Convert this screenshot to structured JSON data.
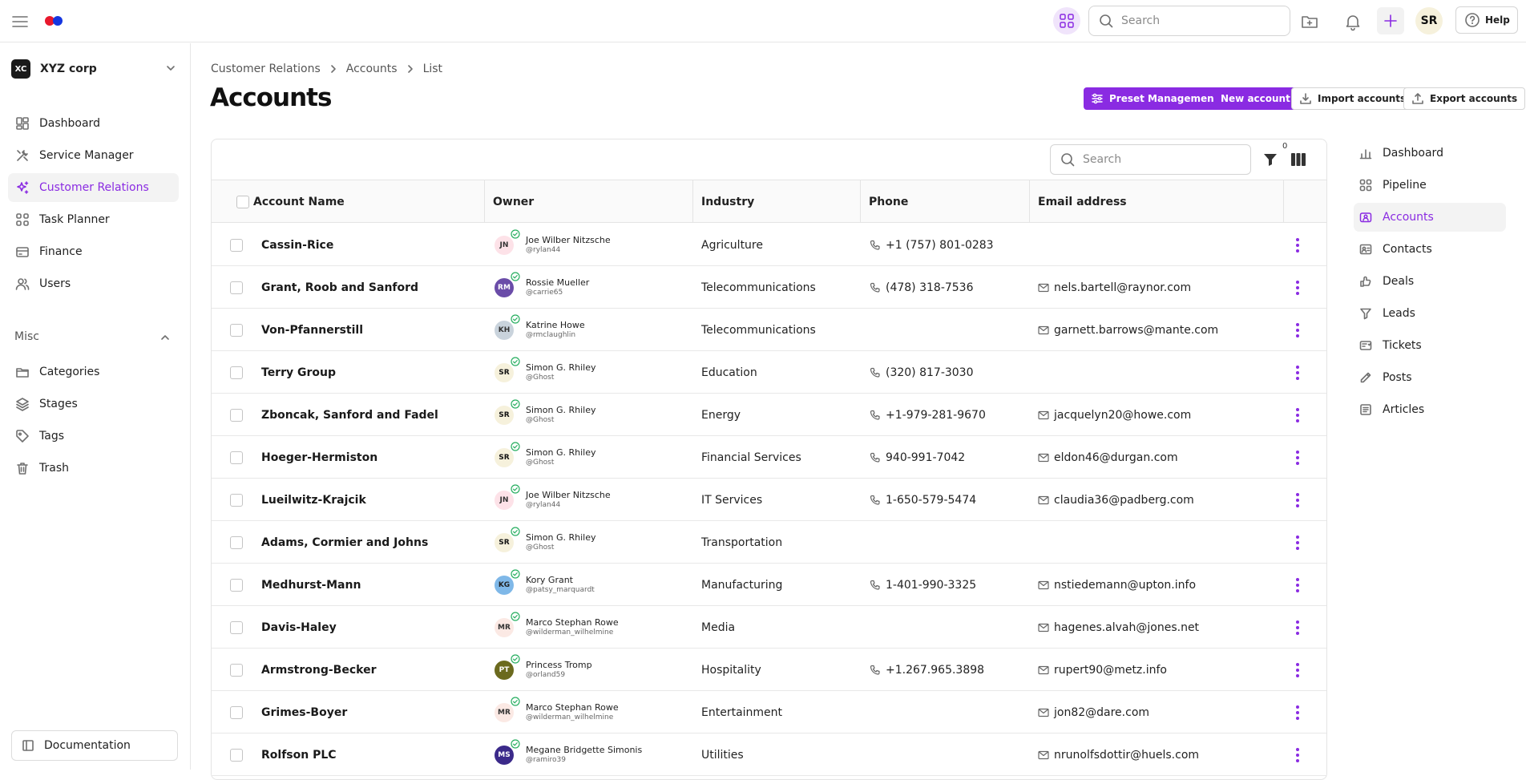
{
  "topbar": {
    "search_placeholder": "Search",
    "user_initials": "SR",
    "help_label": "Help",
    "accent": "#8a2be2",
    "logo_colors": [
      "#e8182c",
      "#1536e0"
    ]
  },
  "sidebar": {
    "org": {
      "badge": "XC",
      "name": "XYZ corp"
    },
    "items": [
      {
        "label": "Dashboard",
        "icon": "dashboard-icon"
      },
      {
        "label": "Service Manager",
        "icon": "tools-icon"
      },
      {
        "label": "Customer Relations",
        "icon": "sparkle-icon",
        "active": true
      },
      {
        "label": "Task Planner",
        "icon": "grid-icon"
      },
      {
        "label": "Finance",
        "icon": "wallet-icon"
      },
      {
        "label": "Users",
        "icon": "users-icon"
      }
    ],
    "misc_label": "Misc",
    "misc_items": [
      {
        "label": "Categories",
        "icon": "folder-icon"
      },
      {
        "label": "Stages",
        "icon": "layers-icon"
      },
      {
        "label": "Tags",
        "icon": "tag-icon"
      },
      {
        "label": "Trash",
        "icon": "trash-icon"
      }
    ],
    "documentation_label": "Documentation"
  },
  "breadcrumb": [
    "Customer Relations",
    "Accounts",
    "List"
  ],
  "page_title": "Accounts",
  "actions": {
    "preset": "Preset Management",
    "new_account": "New account",
    "import": "Import accounts",
    "export": "Export accounts"
  },
  "table": {
    "search_placeholder": "Search",
    "filter_count": "0",
    "columns": [
      "Account Name",
      "Owner",
      "Industry",
      "Phone",
      "Email address"
    ],
    "rows": [
      {
        "name": "Cassin-Rice",
        "owner": {
          "initials": "JN",
          "name": "Joe Wilber Nitzsche",
          "user": "@rylan44",
          "bg": "#fde2e8",
          "fg": "#333"
        },
        "industry": "Agriculture",
        "phone": "+1 (757) 801-0283",
        "email": ""
      },
      {
        "name": "Grant, Roob and Sanford",
        "owner": {
          "initials": "RM",
          "name": "Rossie Mueller",
          "user": "@carrie65",
          "bg": "#6a4ca8",
          "fg": "#fff"
        },
        "industry": "Telecommunications",
        "phone": "(478) 318-7536",
        "email": "nels.bartell@raynor.com"
      },
      {
        "name": "Von-Pfannerstill",
        "owner": {
          "initials": "KH",
          "name": "Katrine Howe",
          "user": "@rmclaughlin",
          "bg": "#c9d3dc",
          "fg": "#333"
        },
        "industry": "Telecommunications",
        "phone": "",
        "email": "garnett.barrows@mante.com"
      },
      {
        "name": "Terry Group",
        "owner": {
          "initials": "SR",
          "name": "Simon G. Rhiley",
          "user": "@Ghost",
          "bg": "#f6f1dc",
          "fg": "#111"
        },
        "industry": "Education",
        "phone": "(320) 817-3030",
        "email": ""
      },
      {
        "name": "Zboncak, Sanford and Fadel",
        "owner": {
          "initials": "SR",
          "name": "Simon G. Rhiley",
          "user": "@Ghost",
          "bg": "#f6f1dc",
          "fg": "#111"
        },
        "industry": "Energy",
        "phone": "+1-979-281-9670",
        "email": "jacquelyn20@howe.com"
      },
      {
        "name": "Hoeger-Hermiston",
        "owner": {
          "initials": "SR",
          "name": "Simon G. Rhiley",
          "user": "@Ghost",
          "bg": "#f6f1dc",
          "fg": "#111"
        },
        "industry": "Financial Services",
        "phone": "940-991-7042",
        "email": "eldon46@durgan.com"
      },
      {
        "name": "Lueilwitz-Krajcik",
        "owner": {
          "initials": "JN",
          "name": "Joe Wilber Nitzsche",
          "user": "@rylan44",
          "bg": "#fde2e8",
          "fg": "#333"
        },
        "industry": "IT Services",
        "phone": "1-650-579-5474",
        "email": "claudia36@padberg.com"
      },
      {
        "name": "Adams, Cormier and Johns",
        "owner": {
          "initials": "SR",
          "name": "Simon G. Rhiley",
          "user": "@Ghost",
          "bg": "#f6f1dc",
          "fg": "#111"
        },
        "industry": "Transportation",
        "phone": "",
        "email": ""
      },
      {
        "name": "Medhurst-Mann",
        "owner": {
          "initials": "KG",
          "name": "Kory Grant",
          "user": "@patsy_marquardt",
          "bg": "#7fb8e8",
          "fg": "#222"
        },
        "industry": "Manufacturing",
        "phone": "1-401-990-3325",
        "email": "nstiedemann@upton.info"
      },
      {
        "name": "Davis-Haley",
        "owner": {
          "initials": "MR",
          "name": "Marco Stephan Rowe",
          "user": "@wilderman_wilhelmine",
          "bg": "#fbe9e4",
          "fg": "#333"
        },
        "industry": "Media",
        "phone": "",
        "email": "hagenes.alvah@jones.net"
      },
      {
        "name": "Armstrong-Becker",
        "owner": {
          "initials": "PT",
          "name": "Princess Tromp",
          "user": "@orland59",
          "bg": "#6b6a1e",
          "fg": "#fff"
        },
        "industry": "Hospitality",
        "phone": "+1.267.965.3898",
        "email": "rupert90@metz.info"
      },
      {
        "name": "Grimes-Boyer",
        "owner": {
          "initials": "MR",
          "name": "Marco Stephan Rowe",
          "user": "@wilderman_wilhelmine",
          "bg": "#fbe9e4",
          "fg": "#333"
        },
        "industry": "Entertainment",
        "phone": "",
        "email": "jon82@dare.com"
      },
      {
        "name": "Rolfson PLC",
        "owner": {
          "initials": "MS",
          "name": "Megane Bridgette Simonis",
          "user": "@ramiro39",
          "bg": "#3b2a8a",
          "fg": "#fff"
        },
        "industry": "Utilities",
        "phone": "",
        "email": "nrunolfsdottir@huels.com"
      }
    ]
  },
  "right_nav": {
    "items": [
      {
        "label": "Dashboard",
        "icon": "bar-chart-icon"
      },
      {
        "label": "Pipeline",
        "icon": "pipeline-icon"
      },
      {
        "label": "Accounts",
        "icon": "accounts-icon",
        "active": true
      },
      {
        "label": "Contacts",
        "icon": "contacts-icon"
      },
      {
        "label": "Deals",
        "icon": "deals-icon"
      },
      {
        "label": "Leads",
        "icon": "funnel-icon"
      },
      {
        "label": "Tickets",
        "icon": "ticket-icon"
      },
      {
        "label": "Posts",
        "icon": "pen-icon"
      },
      {
        "label": "Articles",
        "icon": "article-icon"
      }
    ]
  }
}
